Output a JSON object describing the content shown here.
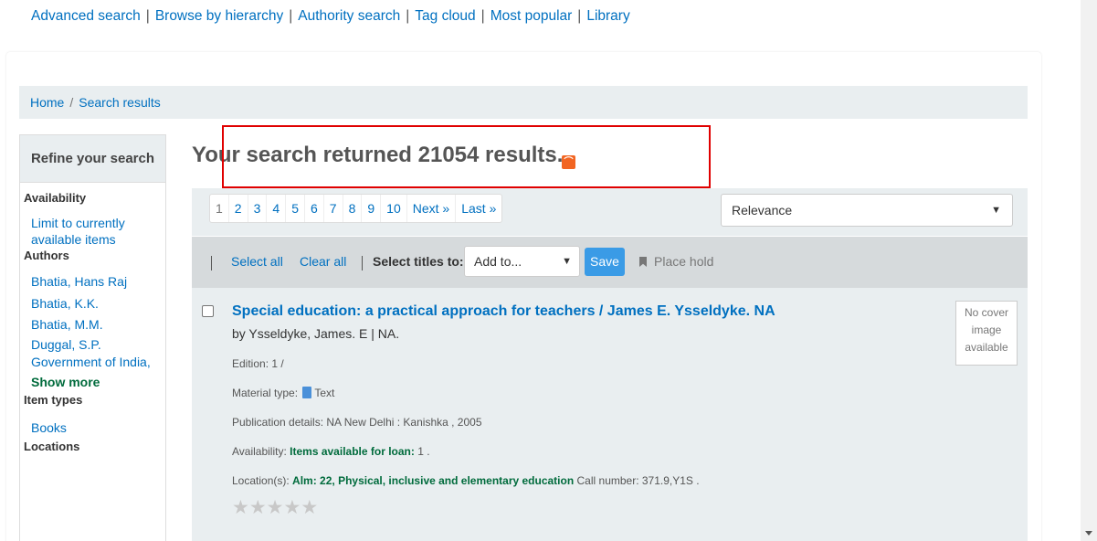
{
  "topnav": {
    "links": [
      "Advanced search",
      "Browse by hierarchy",
      "Authority search",
      "Tag cloud",
      "Most popular",
      "Library"
    ],
    "separator": "|"
  },
  "breadcrumb": {
    "home": "Home",
    "separator": "/",
    "current": "Search results"
  },
  "sidebar": {
    "header": "Refine your search",
    "availability": {
      "title": "Availability",
      "items": [
        "Limit to currently",
        "available items"
      ]
    },
    "authors": {
      "title": "Authors",
      "items": [
        "Bhatia, Hans Raj",
        "Bhatia, K.K.",
        "Bhatia, M.M.",
        "Duggal, S.P.",
        "Government of India,"
      ],
      "more": "Show more"
    },
    "item_types": {
      "title": "Item types",
      "items": [
        "Books"
      ]
    },
    "locations": {
      "title": "Locations"
    }
  },
  "results": {
    "title": "Your search returned 21054 results.",
    "rss_icon": "rss-feed-icon"
  },
  "pagination": {
    "pages": [
      "1",
      "2",
      "3",
      "4",
      "5",
      "6",
      "7",
      "8",
      "9",
      "10"
    ],
    "next": "Next »",
    "last": "Last »"
  },
  "sort": {
    "selected": "Relevance"
  },
  "selection": {
    "select_all": "Select all",
    "clear_all": "Clear all",
    "select_titles_to": "Select titles to:",
    "add_to": "Add to...",
    "save": "Save",
    "place_hold": "Place hold"
  },
  "result": {
    "title": "Special education: a practical approach for teachers / James E. Ysseldyke. NA",
    "author_line": "by Ysseldyke, James. E | NA.",
    "edition": "Edition: 1 /",
    "material_type_label": "Material type:",
    "material_type": "Text",
    "publication": "Publication details: NA New Delhi : Kanishka , 2005",
    "availability_label": "Availability:",
    "availability_value": "Items available for loan:",
    "availability_count": "1 .",
    "location_label": "Location(s):",
    "location_value": "Alm: 22, Physical, inclusive and elementary education",
    "call_number": "Call number: 371.9,Y1S .",
    "no_cover": [
      "No cover",
      "image",
      "available"
    ],
    "rating_stars": 0
  },
  "colors": {
    "link": "#0070c0",
    "highlight_box": "#e00000",
    "save_button": "#3a9be6",
    "rss": "#f26522"
  }
}
